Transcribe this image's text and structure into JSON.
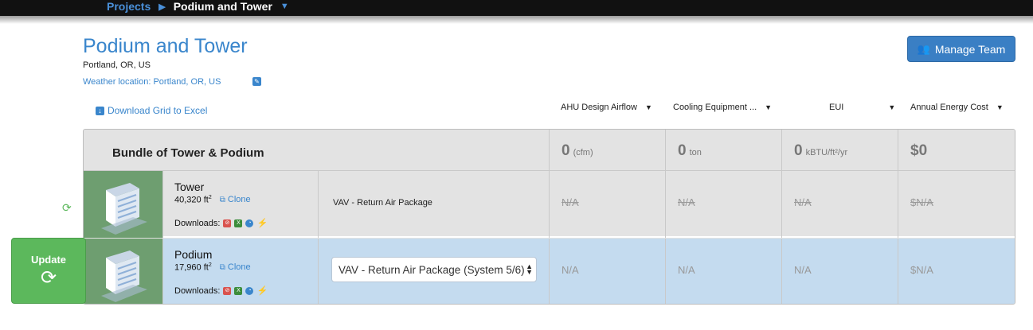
{
  "breadcrumb": {
    "parent": "Projects",
    "separator": "▶",
    "current": "Podium and Tower",
    "caret": "▼"
  },
  "project": {
    "title": "Podium and Tower",
    "location": "Portland, OR, US",
    "weather": "Weather location: Portland, OR, US"
  },
  "toolbar": {
    "manage_team": "Manage Team",
    "download_grid": "Download Grid to Excel"
  },
  "columns": [
    {
      "label": "AHU Design Airflow"
    },
    {
      "label": "Cooling Equipment ..."
    },
    {
      "label": "EUI"
    },
    {
      "label": "Annual Energy Cost"
    }
  ],
  "bundle": {
    "name": "Bundle of Tower & Podium",
    "metrics": [
      {
        "value": "0",
        "unit": "(cfm)"
      },
      {
        "value": "0",
        "unit": "ton"
      },
      {
        "value": "0",
        "unit": "kBTU/ft²/yr"
      },
      {
        "value": "$0",
        "unit": ""
      }
    ]
  },
  "buildings": [
    {
      "name": "Tower",
      "area": "40,320 ft",
      "area_sup": "2",
      "clone": "Clone",
      "downloads": "Downloads:",
      "system": "VAV - Return Air Package",
      "values": [
        "N/A",
        "N/A",
        "N/A",
        "$N/A"
      ]
    },
    {
      "name": "Podium",
      "area": "17,960 ft",
      "area_sup": "2",
      "clone": "Clone",
      "downloads": "Downloads:",
      "system": "VAV - Return Air Package (System 5/6)",
      "values": [
        "N/A",
        "N/A",
        "N/A",
        "$N/A"
      ]
    }
  ],
  "update": {
    "label": "Update"
  },
  "colors": {
    "accent_blue": "#3a86cc",
    "update_green": "#5cb85c",
    "thumb_green": "#6e9e70",
    "selected_row": "#c4dbef"
  }
}
